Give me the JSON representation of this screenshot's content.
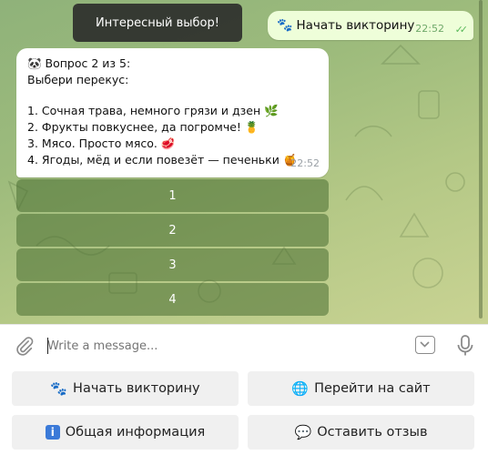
{
  "chat": {
    "toast": "Интересный выбор!",
    "outgoing": {
      "paw": "🐾",
      "text": "Начать викторину",
      "time": "22:52",
      "checks": "✓✓"
    },
    "incoming": {
      "lines": [
        "🐼 Вопрос 2 из 5:",
        "Выбери перекус:",
        "",
        "1. Сочная трава, немного грязи и дзен 🌿",
        "2. Фрукты повкуснее, да погромче! 🍍",
        "3. Мясо. Просто мясо. 🥩",
        "4. Ягоды, мёд и если повезёт — печеньки 🍯"
      ],
      "time": "22:52"
    },
    "inline_keyboard": [
      "1",
      "2",
      "3",
      "4"
    ]
  },
  "composer": {
    "placeholder": "Write a message..."
  },
  "reply_keyboard": [
    {
      "emoji": "🐾",
      "label": "Начать викторину"
    },
    {
      "emoji": "🌐",
      "label": "Перейти на сайт"
    },
    {
      "emoji": "i",
      "label": "Общая информация"
    },
    {
      "emoji": "💬",
      "label": "Оставить отзыв"
    }
  ],
  "colors": {
    "outgoing_bubble": "#eefed9",
    "inline_button": "#486e32",
    "checks": "#59b95a"
  }
}
